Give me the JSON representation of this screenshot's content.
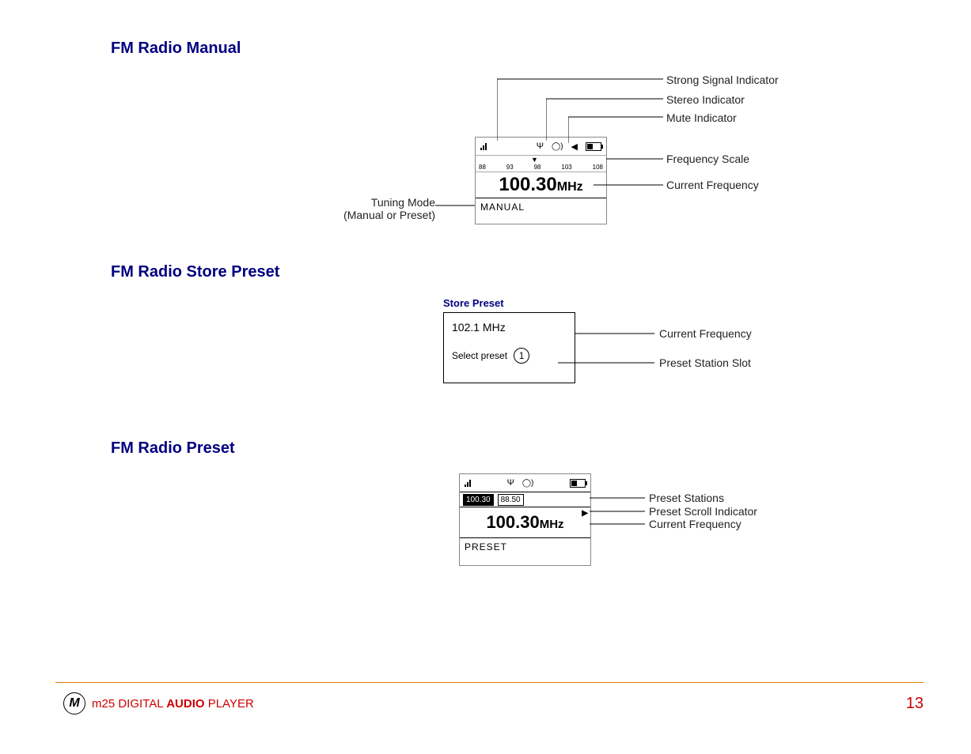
{
  "sections": {
    "manual_heading": "FM Radio Manual",
    "store_heading": "FM Radio Store Preset",
    "preset_heading": "FM Radio Preset"
  },
  "fig1": {
    "scale_ticks": [
      "88",
      "93",
      "98",
      "103",
      "108"
    ],
    "frequency_value": "100.30",
    "frequency_unit": "MHz",
    "mode_label": "MANUAL",
    "tuning_mode_label": "Tuning Mode",
    "tuning_mode_sub": "(Manual or Preset)",
    "callouts": {
      "strong_signal": "Strong Signal Indicator",
      "stereo": "Stereo Indicator",
      "mute": "Mute Indicator",
      "freq_scale": "Frequency Scale",
      "current_freq": "Current Frequency"
    }
  },
  "fig2": {
    "title": "Store Preset",
    "freq": "102.1 MHz",
    "select_label": "Select preset",
    "slot_number": "1",
    "callouts": {
      "current_freq": "Current Frequency",
      "preset_slot": "Preset Station Slot"
    }
  },
  "fig3": {
    "presets": [
      "100.30",
      "88.50"
    ],
    "frequency_value": "100.30",
    "frequency_unit": "MHz",
    "mode_label": "PRESET",
    "callouts": {
      "preset_stations": "Preset Stations",
      "scroll_indicator": "Preset Scroll Indicator",
      "current_freq": "Current Frequency"
    }
  },
  "footer": {
    "product_prefix": "m25 DIGITAL ",
    "product_audio": "AUDIO",
    "product_suffix": " PLAYER",
    "page_number": "13",
    "logo_char": "M"
  }
}
